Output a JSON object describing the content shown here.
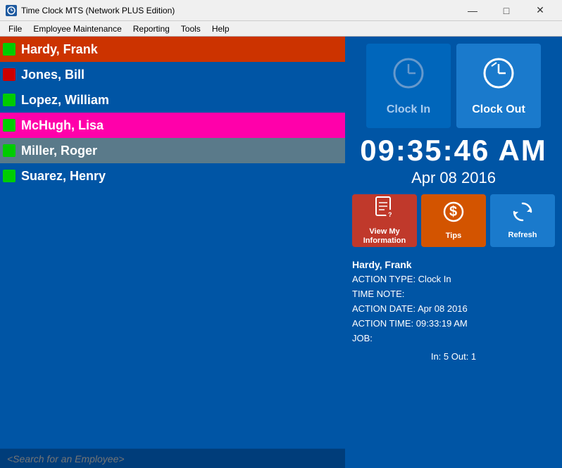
{
  "window": {
    "title": "Time Clock MTS (Network PLUS Edition)",
    "icon": "clock-icon"
  },
  "titlebar": {
    "minimize": "—",
    "maximize": "□",
    "close": "✕"
  },
  "menu": {
    "items": [
      {
        "id": "file",
        "label": "File"
      },
      {
        "id": "employee-maintenance",
        "label": "Employee Maintenance"
      },
      {
        "id": "reporting",
        "label": "Reporting"
      },
      {
        "id": "tools",
        "label": "Tools"
      },
      {
        "id": "help",
        "label": "Help"
      }
    ]
  },
  "employees": [
    {
      "id": "hardy-frank",
      "name": "Hardy, Frank",
      "status_color": "#00cc00",
      "selected": "main"
    },
    {
      "id": "jones-bill",
      "name": "Jones, Bill",
      "status_color": "#cc0000",
      "selected": "none"
    },
    {
      "id": "lopez-william",
      "name": "Lopez, William",
      "status_color": "#00cc00",
      "selected": "none"
    },
    {
      "id": "mchugh-lisa",
      "name": "McHugh, Lisa",
      "status_color": "#00cc00",
      "selected": "magenta"
    },
    {
      "id": "miller-roger",
      "name": "Miller, Roger",
      "status_color": "#00cc00",
      "selected": "gray"
    },
    {
      "id": "suarez-henry",
      "name": "Suarez, Henry",
      "status_color": "#00cc00",
      "selected": "none"
    }
  ],
  "search": {
    "placeholder": "<Search for an Employee>"
  },
  "clock_in_button": {
    "label": "Clock In"
  },
  "clock_out_button": {
    "label": "Clock Out"
  },
  "time": {
    "current": "09:35:46 AM",
    "date": "Apr 08 2016"
  },
  "action_buttons": {
    "view_info": {
      "label": "View My\nInformation",
      "icon": "📄"
    },
    "tips": {
      "label": "Tips",
      "icon": "$"
    },
    "refresh": {
      "label": "Refresh",
      "icon": "↻"
    }
  },
  "last_action": {
    "name": "Hardy, Frank",
    "action_type": "Clock In",
    "time_note": "",
    "action_date": "Apr 08 2016",
    "action_time": "09:33:19 AM",
    "job": ""
  },
  "stats": {
    "in": "5",
    "out": "1",
    "label": "In: 5  Out: 1"
  }
}
